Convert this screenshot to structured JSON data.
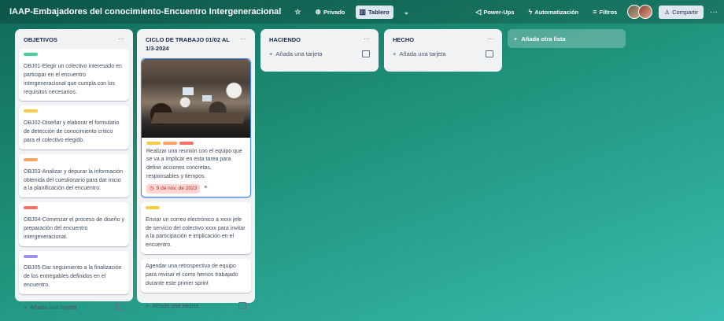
{
  "header": {
    "board_title": "IAAP-Embajadores del conocimiento-Encuentro Intergeneracional",
    "visibility": "Privado",
    "view": "Tablero",
    "power_ups": "Power-Ups",
    "automation": "Automatización",
    "filters": "Filtros",
    "share": "Compartir"
  },
  "lists": [
    {
      "title": "OBJETIVOS",
      "cards": [
        {
          "label_color": "#4bce97",
          "text": "OBJ01-Elegir un colectivo interesado en participar en el encuentro intergeneracional que cumpla con los requisitos necesarios."
        },
        {
          "label_color": "#f5cd47",
          "text": "OBJ02-Diseñar y elaborar el formulario de detección de conocimiento crítico para el colectivo elegido."
        },
        {
          "label_color": "#fea362",
          "text": "OBJ03-Analizar y depurar la información obtenida del cuestionario para dar inicio a la planificación del encuentro."
        },
        {
          "label_color": "#f87168",
          "text": "OBJ04-Comenzar el proceso de diseño y preparación del encuentro intergeneracional."
        },
        {
          "label_color": "#9f8fef",
          "text": "OBJ05-Dar seguimiento a la finalización de los entregables definidos en el encuentro."
        }
      ],
      "add_card": "Añada una tarjeta"
    },
    {
      "title": "CICLO DE TRABAJO 01/02 AL 1/3-2024",
      "cards": [
        {
          "labels": [
            "#f5cd47",
            "#fea362",
            "#f87168"
          ],
          "text": "Realizar una reunión con el equipo que se va a implicar en esta tarea para definir acciones concretas, responsables y tiempos.",
          "due": "9 de nov. de 2023"
        },
        {
          "label_color": "#f5cd47",
          "text": "Enviar un correo electrónico a xxxx jefe de servicio del colectivo xxxx para invitar a la participación e implicación en el encuentro."
        },
        {
          "text": "Agendar una retrospectiva de equipo para revisar el como hemos trabajado durante este primer sprint"
        }
      ],
      "add_card": "Añada una tarjeta"
    },
    {
      "title": "HACIENDO",
      "add_card": "Añada una tarjeta"
    },
    {
      "title": "HECHO",
      "add_card": "Añada una tarjeta"
    }
  ],
  "add_list": "Añada otra lista",
  "icons": [
    "star-icon",
    "globe-icon",
    "board-icon",
    "chevron-down-icon",
    "rocket-icon",
    "lightning-icon",
    "filter-icon",
    "person-add-icon",
    "more-icon",
    "plus-icon",
    "template-icon",
    "clock-icon",
    "description-icon"
  ]
}
